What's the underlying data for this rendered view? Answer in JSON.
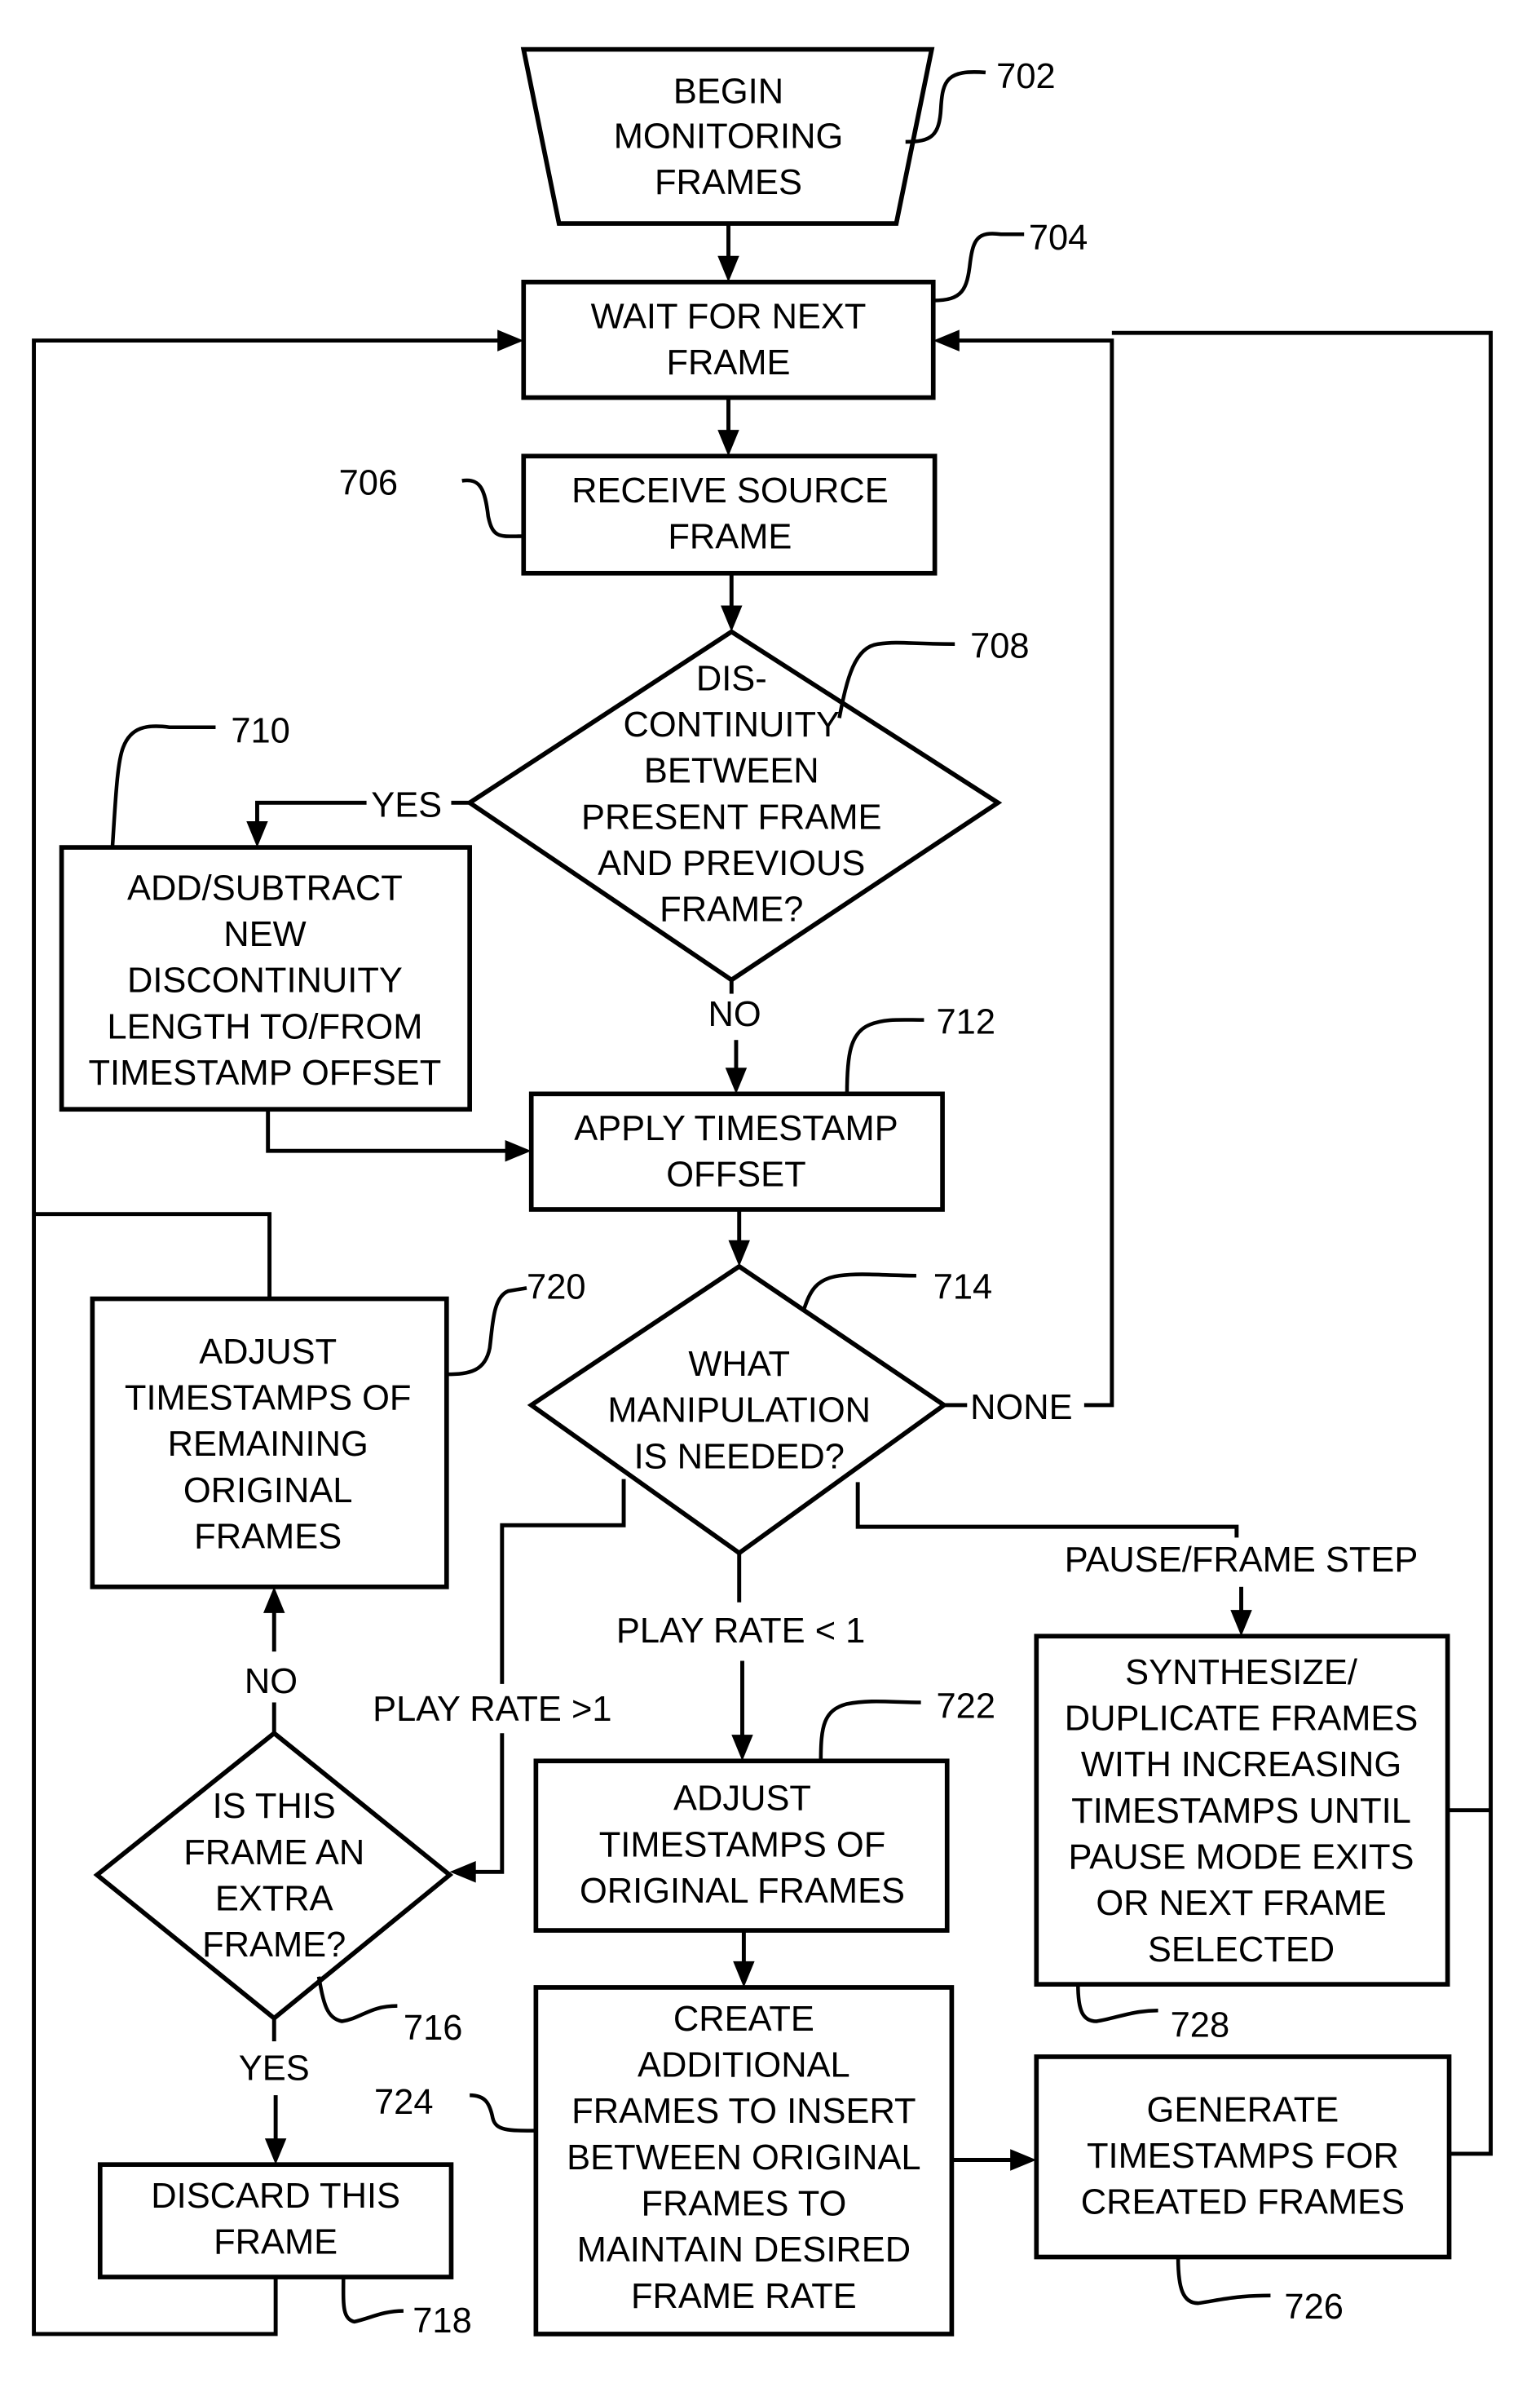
{
  "figure": {
    "nodes": {
      "n702": {
        "ref": "702",
        "lines": [
          "BEGIN",
          "MONITORING",
          "FRAMES"
        ]
      },
      "n704": {
        "ref": "704",
        "lines": [
          "WAIT FOR NEXT",
          "FRAME"
        ]
      },
      "n706": {
        "ref": "706",
        "lines": [
          "RECEIVE SOURCE",
          "FRAME"
        ]
      },
      "n708": {
        "ref": "708",
        "lines": [
          "DIS-",
          "CONTINUITY",
          "BETWEEN",
          "PRESENT FRAME",
          "AND PREVIOUS",
          "FRAME?"
        ]
      },
      "n710": {
        "ref": "710",
        "lines": [
          "ADD/SUBTRACT",
          "NEW",
          "DISCONTINUITY",
          "LENGTH TO/FROM",
          "TIMESTAMP OFFSET"
        ]
      },
      "n712": {
        "ref": "712",
        "lines": [
          "APPLY TIMESTAMP",
          "OFFSET"
        ]
      },
      "n714": {
        "ref": "714",
        "lines": [
          "WHAT",
          "MANIPULATION",
          "IS NEEDED?"
        ]
      },
      "n716": {
        "ref": "716",
        "lines": [
          "IS THIS",
          "FRAME AN",
          "EXTRA",
          "FRAME?"
        ]
      },
      "n718": {
        "ref": "718",
        "lines": [
          "DISCARD THIS",
          "FRAME"
        ]
      },
      "n720": {
        "ref": "720",
        "lines": [
          "ADJUST",
          "TIMESTAMPS OF",
          "REMAINING",
          "ORIGINAL",
          "FRAMES"
        ]
      },
      "n722": {
        "ref": "722",
        "lines": [
          "ADJUST",
          "TIMESTAMPS OF",
          "ORIGINAL FRAMES"
        ]
      },
      "n724": {
        "ref": "724",
        "lines": [
          "CREATE",
          "ADDITIONAL",
          "FRAMES TO INSERT",
          "BETWEEN ORIGINAL",
          "FRAMES TO",
          "MAINTAIN DESIRED",
          "FRAME RATE"
        ]
      },
      "n726": {
        "ref": "726",
        "lines": [
          "GENERATE",
          "TIMESTAMPS FOR",
          "CREATED FRAMES"
        ]
      },
      "n728": {
        "ref": "728",
        "lines": [
          "SYNTHESIZE/",
          "DUPLICATE FRAMES",
          "WITH INCREASING",
          "TIMESTAMPS UNTIL",
          "PAUSE MODE EXITS",
          "OR NEXT FRAME",
          "SELECTED"
        ]
      }
    },
    "edge_labels": {
      "yes_708": "YES",
      "no_708": "NO",
      "none_714": "NONE",
      "play_rate_lt1": "PLAY RATE < 1",
      "play_rate_gt1": "PLAY RATE >1",
      "pause_frame_step": "PAUSE/FRAME STEP",
      "no_716": "NO",
      "yes_716": "YES"
    }
  }
}
